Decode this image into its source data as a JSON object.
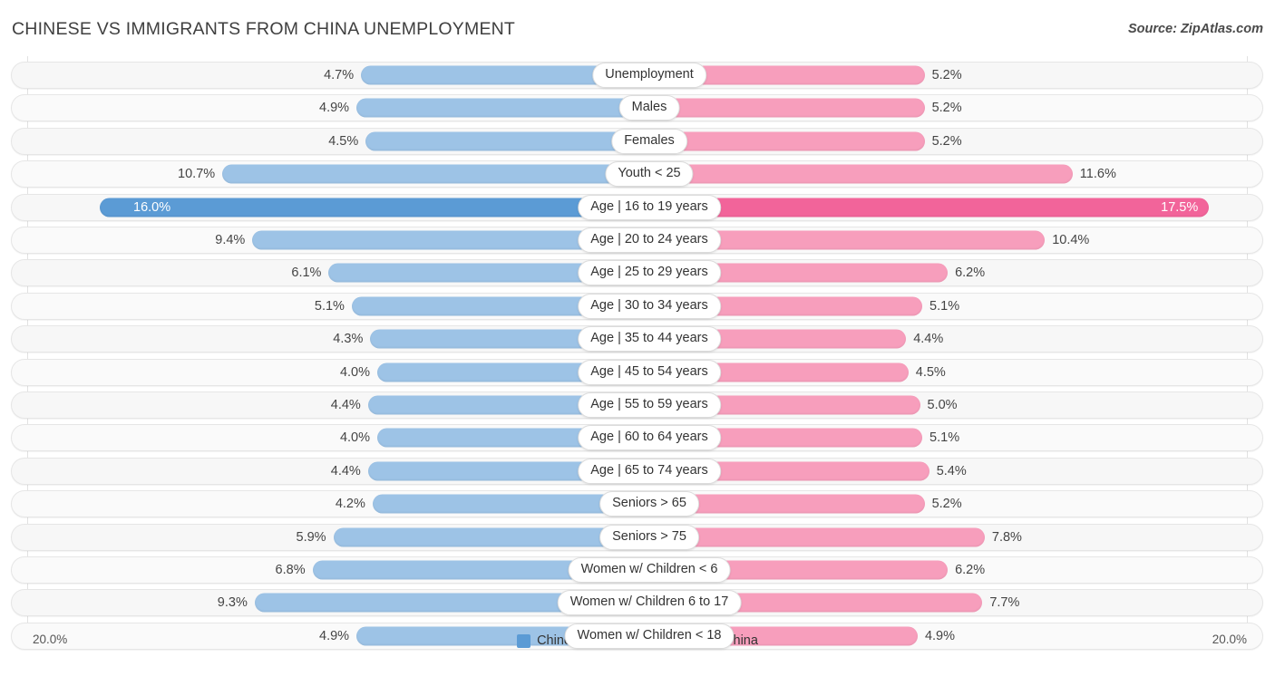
{
  "header": {
    "title": "CHINESE VS IMMIGRANTS FROM CHINA UNEMPLOYMENT",
    "source": "Source: ZipAtlas.com"
  },
  "axis": {
    "left_label": "20.0%",
    "right_label": "20.0%",
    "max": 20.0
  },
  "legend": {
    "items": [
      {
        "label": "Chinese",
        "color": "#5b9bd5"
      },
      {
        "label": "Immigrants from China",
        "color": "#f2649a"
      }
    ]
  },
  "colors": {
    "left_bar": "#9dc3e6",
    "right_bar": "#f79ebc",
    "left_bar_highlight": "#5b9bd5",
    "right_bar_highlight": "#f2649a",
    "row_background": "#f7f7f7",
    "gridline": "#e2e2e2"
  },
  "chart_data": {
    "type": "bar",
    "title": "CHINESE VS IMMIGRANTS FROM CHINA UNEMPLOYMENT",
    "subtitle": "",
    "orientation": "horizontal-diverging",
    "xlabel": "",
    "ylabel": "",
    "xlim": [
      20.0,
      20.0
    ],
    "grid": true,
    "legend_position": "bottom-center",
    "categories": [
      "Unemployment",
      "Males",
      "Females",
      "Youth < 25",
      "Age | 16 to 19 years",
      "Age | 20 to 24 years",
      "Age | 25 to 29 years",
      "Age | 30 to 34 years",
      "Age | 35 to 44 years",
      "Age | 45 to 54 years",
      "Age | 55 to 59 years",
      "Age | 60 to 64 years",
      "Age | 65 to 74 years",
      "Seniors > 65",
      "Seniors > 75",
      "Women w/ Children < 6",
      "Women w/ Children 6 to 17",
      "Women w/ Children < 18"
    ],
    "series": [
      {
        "name": "Chinese",
        "color": "#5b9bd5",
        "values": [
          4.7,
          4.9,
          4.5,
          10.7,
          16.0,
          9.4,
          6.1,
          5.1,
          4.3,
          4.0,
          4.4,
          4.0,
          4.4,
          4.2,
          5.9,
          6.8,
          9.3,
          4.9
        ],
        "labels": [
          "4.7%",
          "4.9%",
          "4.5%",
          "10.7%",
          "16.0%",
          "9.4%",
          "6.1%",
          "5.1%",
          "4.3%",
          "4.0%",
          "4.4%",
          "4.0%",
          "4.4%",
          "4.2%",
          "5.9%",
          "6.8%",
          "9.3%",
          "4.9%"
        ]
      },
      {
        "name": "Immigrants from China",
        "color": "#f2649a",
        "values": [
          5.2,
          5.2,
          5.2,
          11.6,
          17.5,
          10.4,
          6.2,
          5.1,
          4.4,
          4.5,
          5.0,
          5.1,
          5.4,
          5.2,
          7.8,
          6.2,
          7.7,
          4.9
        ],
        "labels": [
          "5.2%",
          "5.2%",
          "5.2%",
          "11.6%",
          "17.5%",
          "10.4%",
          "6.2%",
          "5.1%",
          "4.4%",
          "4.5%",
          "5.0%",
          "5.1%",
          "5.4%",
          "5.2%",
          "7.8%",
          "6.2%",
          "7.7%",
          "4.9%"
        ]
      }
    ],
    "highlighted_row": "Age | 16 to 19 years"
  }
}
